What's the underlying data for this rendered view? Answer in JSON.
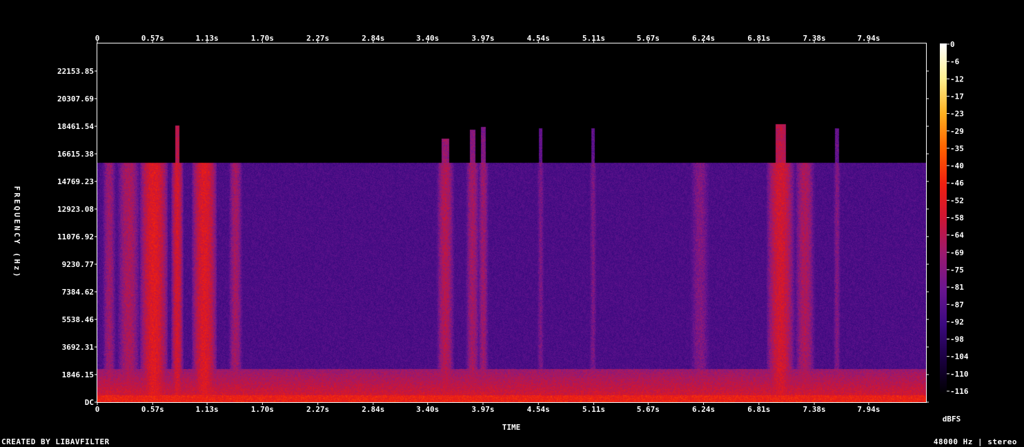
{
  "chart_data": {
    "type": "heatmap",
    "title": "",
    "xlabel": "TIME",
    "ylabel": "FREQUENCY (Hz)",
    "x_ticks": [
      "0",
      "0.57s",
      "1.13s",
      "1.70s",
      "2.27s",
      "2.84s",
      "3.40s",
      "3.97s",
      "4.54s",
      "5.11s",
      "5.67s",
      "6.24s",
      "6.81s",
      "7.38s",
      "7.94s"
    ],
    "x_tick_values": [
      0,
      0.57,
      1.13,
      1.7,
      2.27,
      2.84,
      3.4,
      3.97,
      4.54,
      5.11,
      5.67,
      6.24,
      6.81,
      7.38,
      7.94
    ],
    "xlim": [
      0,
      8.53
    ],
    "y_ticks": [
      "DC",
      "1846.15",
      "3692.31",
      "5538.46",
      "7384.62",
      "9230.77",
      "11076.92",
      "12923.08",
      "14769.23",
      "16615.38",
      "18461.54",
      "20307.69",
      "22153.85"
    ],
    "y_tick_values": [
      0,
      1846.15,
      3692.31,
      5538.46,
      7384.62,
      9230.77,
      11076.92,
      12923.08,
      14769.23,
      16615.38,
      18461.54,
      20307.69,
      22153.85
    ],
    "ylim": [
      0,
      24000
    ],
    "colorbar": {
      "label": "dBFS",
      "ticks": [
        "0",
        "-6",
        "-12",
        "-17",
        "-23",
        "-29",
        "-35",
        "-40",
        "-46",
        "-52",
        "-58",
        "-64",
        "-69",
        "-75",
        "-81",
        "-87",
        "-92",
        "-98",
        "-104",
        "-110",
        "-116"
      ],
      "range": [
        -120,
        0
      ],
      "colors": [
        "#000000",
        "#1a0040",
        "#3c0a80",
        "#6a1590",
        "#9a1a70",
        "#cc1535",
        "#f02010",
        "#ff6000",
        "#ffb020",
        "#fff090",
        "#ffffff"
      ]
    },
    "noise_floor_cutoff_hz": 16000,
    "noise_floor_dbfs": -92,
    "low_band": {
      "upper_hz": 2200,
      "level_dbfs": -55
    },
    "events": [
      {
        "t": 0.12,
        "w": 0.05,
        "level_dbfs": -72,
        "top_hz": 16000
      },
      {
        "t": 0.32,
        "w": 0.08,
        "level_dbfs": -68,
        "top_hz": 16000
      },
      {
        "t": 0.58,
        "w": 0.09,
        "level_dbfs": -54,
        "top_hz": 16000
      },
      {
        "t": 0.82,
        "w": 0.04,
        "level_dbfs": -58,
        "top_hz": 18500
      },
      {
        "t": 1.1,
        "w": 0.08,
        "level_dbfs": -55,
        "top_hz": 16000
      },
      {
        "t": 1.42,
        "w": 0.05,
        "level_dbfs": -70,
        "top_hz": 16000
      },
      {
        "t": 3.58,
        "w": 0.06,
        "level_dbfs": -66,
        "top_hz": 17600
      },
      {
        "t": 3.86,
        "w": 0.05,
        "level_dbfs": -70,
        "top_hz": 18200
      },
      {
        "t": 3.97,
        "w": 0.04,
        "level_dbfs": -72,
        "top_hz": 18400
      },
      {
        "t": 4.56,
        "w": 0.03,
        "level_dbfs": -80,
        "top_hz": 18300
      },
      {
        "t": 5.1,
        "w": 0.03,
        "level_dbfs": -80,
        "top_hz": 18300
      },
      {
        "t": 6.2,
        "w": 0.08,
        "level_dbfs": -78,
        "top_hz": 16000
      },
      {
        "t": 7.03,
        "w": 0.09,
        "level_dbfs": -58,
        "top_hz": 18600
      },
      {
        "t": 7.28,
        "w": 0.07,
        "level_dbfs": -68,
        "top_hz": 16000
      },
      {
        "t": 7.61,
        "w": 0.03,
        "level_dbfs": -78,
        "top_hz": 18300
      }
    ]
  },
  "footer": {
    "left": "CREATED BY LIBAVFILTER",
    "right": "48000 Hz | stereo"
  }
}
